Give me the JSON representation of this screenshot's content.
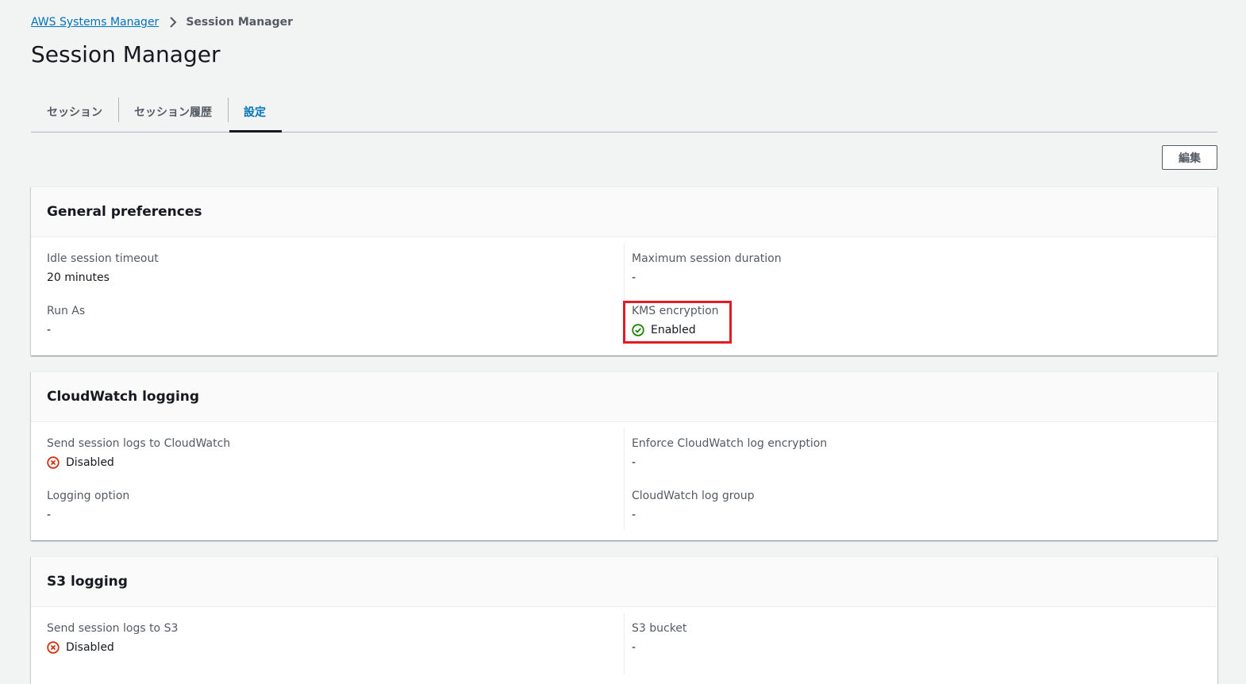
{
  "breadcrumb": {
    "parent": "AWS Systems Manager",
    "current": "Session Manager"
  },
  "page_title": "Session Manager",
  "tabs": [
    {
      "label": "セッション",
      "active": false
    },
    {
      "label": "セッション履歴",
      "active": false
    },
    {
      "label": "設定",
      "active": true
    }
  ],
  "edit_button_label": "編集",
  "general": {
    "title": "General preferences",
    "idle_timeout_label": "Idle session timeout",
    "idle_timeout_value": "20 minutes",
    "max_duration_label": "Maximum session duration",
    "max_duration_value": "-",
    "run_as_label": "Run As",
    "run_as_value": "-",
    "kms_label": "KMS encryption",
    "kms_value": "Enabled"
  },
  "cloudwatch": {
    "title": "CloudWatch logging",
    "send_logs_label": "Send session logs to CloudWatch",
    "send_logs_value": "Disabled",
    "enforce_label": "Enforce CloudWatch log encryption",
    "enforce_value": "-",
    "logging_option_label": "Logging option",
    "logging_option_value": "-",
    "log_group_label": "CloudWatch log group",
    "log_group_value": "-"
  },
  "s3": {
    "title": "S3 logging",
    "send_logs_label": "Send session logs to S3",
    "send_logs_value": "Disabled",
    "bucket_label": "S3 bucket",
    "bucket_value": "-"
  },
  "colors": {
    "link": "#0073bb",
    "success": "#1d8102",
    "error": "#d13212",
    "highlight": "#e31b23"
  }
}
